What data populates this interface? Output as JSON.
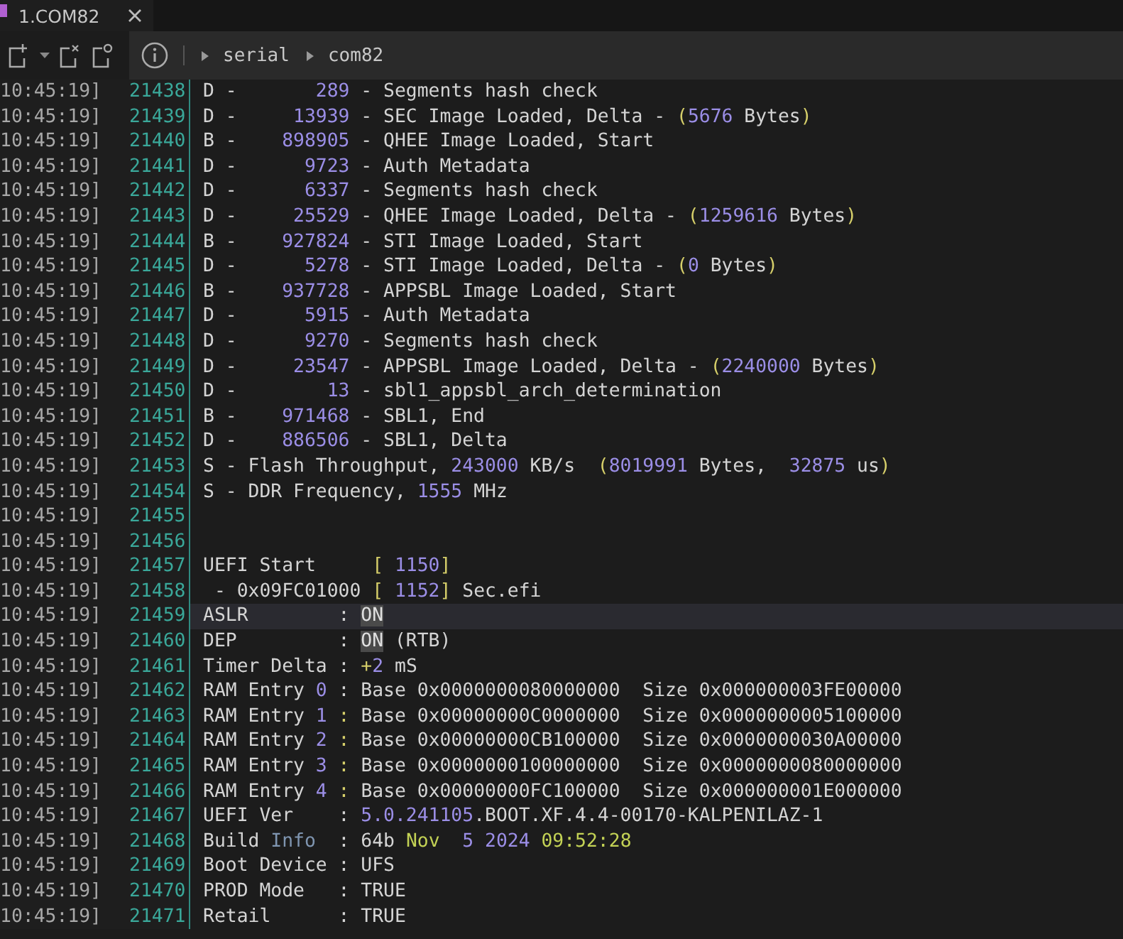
{
  "tabs": [
    {
      "label": "1.COM82",
      "selected": true
    }
  ],
  "breadcrumb": [
    "serial",
    "com82"
  ],
  "log": [
    {
      "time": "10:45:19]",
      "line": "21438",
      "selected": false,
      "segments": [
        {
          "kind": "text",
          "text": "D -       "
        },
        {
          "kind": "number",
          "text": "289"
        },
        {
          "kind": "text",
          "text": " - Segments hash check"
        }
      ]
    },
    {
      "time": "10:45:19]",
      "line": "21439",
      "selected": false,
      "segments": [
        {
          "kind": "text",
          "text": "D -     "
        },
        {
          "kind": "number",
          "text": "13939"
        },
        {
          "kind": "text",
          "text": " - SEC Image Loaded, Delta - "
        },
        {
          "kind": "punct",
          "text": "("
        },
        {
          "kind": "number",
          "text": "5676"
        },
        {
          "kind": "text",
          "text": " Bytes"
        },
        {
          "kind": "punct",
          "text": ")"
        }
      ]
    },
    {
      "time": "10:45:19]",
      "line": "21440",
      "selected": false,
      "segments": [
        {
          "kind": "text",
          "text": "B -    "
        },
        {
          "kind": "number",
          "text": "898905"
        },
        {
          "kind": "text",
          "text": " - QHEE Image Loaded, Start"
        }
      ]
    },
    {
      "time": "10:45:19]",
      "line": "21441",
      "selected": false,
      "segments": [
        {
          "kind": "text",
          "text": "D -      "
        },
        {
          "kind": "number",
          "text": "9723"
        },
        {
          "kind": "text",
          "text": " - Auth Metadata"
        }
      ]
    },
    {
      "time": "10:45:19]",
      "line": "21442",
      "selected": false,
      "segments": [
        {
          "kind": "text",
          "text": "D -      "
        },
        {
          "kind": "number",
          "text": "6337"
        },
        {
          "kind": "text",
          "text": " - Segments hash check"
        }
      ]
    },
    {
      "time": "10:45:19]",
      "line": "21443",
      "selected": false,
      "segments": [
        {
          "kind": "text",
          "text": "D -     "
        },
        {
          "kind": "number",
          "text": "25529"
        },
        {
          "kind": "text",
          "text": " - QHEE Image Loaded, Delta - "
        },
        {
          "kind": "punct",
          "text": "("
        },
        {
          "kind": "number",
          "text": "1259616"
        },
        {
          "kind": "text",
          "text": " Bytes"
        },
        {
          "kind": "punct",
          "text": ")"
        }
      ]
    },
    {
      "time": "10:45:19]",
      "line": "21444",
      "selected": false,
      "segments": [
        {
          "kind": "text",
          "text": "B -    "
        },
        {
          "kind": "number",
          "text": "927824"
        },
        {
          "kind": "text",
          "text": " - STI Image Loaded, Start"
        }
      ]
    },
    {
      "time": "10:45:19]",
      "line": "21445",
      "selected": false,
      "segments": [
        {
          "kind": "text",
          "text": "D -      "
        },
        {
          "kind": "number",
          "text": "5278"
        },
        {
          "kind": "text",
          "text": " - STI Image Loaded, Delta - "
        },
        {
          "kind": "punct",
          "text": "("
        },
        {
          "kind": "number",
          "text": "0"
        },
        {
          "kind": "text",
          "text": " Bytes"
        },
        {
          "kind": "punct",
          "text": ")"
        }
      ]
    },
    {
      "time": "10:45:19]",
      "line": "21446",
      "selected": false,
      "segments": [
        {
          "kind": "text",
          "text": "B -    "
        },
        {
          "kind": "number",
          "text": "937728"
        },
        {
          "kind": "text",
          "text": " - APPSBL Image Loaded, Start"
        }
      ]
    },
    {
      "time": "10:45:19]",
      "line": "21447",
      "selected": false,
      "segments": [
        {
          "kind": "text",
          "text": "D -      "
        },
        {
          "kind": "number",
          "text": "5915"
        },
        {
          "kind": "text",
          "text": " - Auth Metadata"
        }
      ]
    },
    {
      "time": "10:45:19]",
      "line": "21448",
      "selected": false,
      "segments": [
        {
          "kind": "text",
          "text": "D -      "
        },
        {
          "kind": "number",
          "text": "9270"
        },
        {
          "kind": "text",
          "text": " - Segments hash check"
        }
      ]
    },
    {
      "time": "10:45:19]",
      "line": "21449",
      "selected": false,
      "segments": [
        {
          "kind": "text",
          "text": "D -     "
        },
        {
          "kind": "number",
          "text": "23547"
        },
        {
          "kind": "text",
          "text": " - APPSBL Image Loaded, Delta - "
        },
        {
          "kind": "punct",
          "text": "("
        },
        {
          "kind": "number",
          "text": "2240000"
        },
        {
          "kind": "text",
          "text": " Bytes"
        },
        {
          "kind": "punct",
          "text": ")"
        }
      ]
    },
    {
      "time": "10:45:19]",
      "line": "21450",
      "selected": false,
      "segments": [
        {
          "kind": "text",
          "text": "D -        "
        },
        {
          "kind": "number",
          "text": "13"
        },
        {
          "kind": "text",
          "text": " - sbl1_appsbl_arch_determination"
        }
      ]
    },
    {
      "time": "10:45:19]",
      "line": "21451",
      "selected": false,
      "segments": [
        {
          "kind": "text",
          "text": "B -    "
        },
        {
          "kind": "number",
          "text": "971468"
        },
        {
          "kind": "text",
          "text": " - SBL1, End"
        }
      ]
    },
    {
      "time": "10:45:19]",
      "line": "21452",
      "selected": false,
      "segments": [
        {
          "kind": "text",
          "text": "D -    "
        },
        {
          "kind": "number",
          "text": "886506"
        },
        {
          "kind": "text",
          "text": " - SBL1, Delta"
        }
      ]
    },
    {
      "time": "10:45:19]",
      "line": "21453",
      "selected": false,
      "segments": [
        {
          "kind": "text",
          "text": "S - Flash Throughput, "
        },
        {
          "kind": "number",
          "text": "243000"
        },
        {
          "kind": "text",
          "text": " KB/s  "
        },
        {
          "kind": "punct",
          "text": "("
        },
        {
          "kind": "number",
          "text": "8019991"
        },
        {
          "kind": "text",
          "text": " Bytes,  "
        },
        {
          "kind": "number",
          "text": "32875"
        },
        {
          "kind": "text",
          "text": " us"
        },
        {
          "kind": "punct",
          "text": ")"
        }
      ]
    },
    {
      "time": "10:45:19]",
      "line": "21454",
      "selected": false,
      "segments": [
        {
          "kind": "text",
          "text": "S - DDR Frequency, "
        },
        {
          "kind": "number",
          "text": "1555"
        },
        {
          "kind": "text",
          "text": " MHz"
        }
      ]
    },
    {
      "time": "10:45:19]",
      "line": "21455",
      "selected": false
    },
    {
      "time": "10:45:19]",
      "line": "21456",
      "selected": false
    },
    {
      "time": "10:45:19]",
      "line": "21457",
      "selected": false,
      "segments": [
        {
          "kind": "text",
          "text": "UEFI Start     "
        },
        {
          "kind": "punct",
          "text": "[ "
        },
        {
          "kind": "number",
          "text": "1150"
        },
        {
          "kind": "punct",
          "text": "]"
        }
      ]
    },
    {
      "time": "10:45:19]",
      "line": "21458",
      "selected": false,
      "segments": [
        {
          "kind": "text",
          "text": " - 0x09FC01000 "
        },
        {
          "kind": "punct",
          "text": "[ "
        },
        {
          "kind": "number",
          "text": "1152"
        },
        {
          "kind": "punct",
          "text": "]"
        },
        {
          "kind": "text",
          "text": " Sec.efi"
        }
      ]
    },
    {
      "time": "10:45:19]",
      "line": "21459",
      "selected": true,
      "segments": [
        {
          "kind": "text",
          "text": "ASLR        : "
        },
        {
          "kind": "match",
          "text": "ON"
        }
      ]
    },
    {
      "time": "10:45:19]",
      "line": "21460",
      "selected": false,
      "segments": [
        {
          "kind": "text",
          "text": "DEP         : "
        },
        {
          "kind": "match",
          "text": "ON"
        },
        {
          "kind": "text",
          "text": " (RTB)"
        }
      ]
    },
    {
      "time": "10:45:19]",
      "line": "21461",
      "selected": false,
      "segments": [
        {
          "kind": "text",
          "text": "Timer Delta : "
        },
        {
          "kind": "punct",
          "text": "+"
        },
        {
          "kind": "number",
          "text": "2"
        },
        {
          "kind": "text",
          "text": " mS"
        }
      ]
    },
    {
      "time": "10:45:19]",
      "line": "21462",
      "selected": false,
      "segments": [
        {
          "kind": "text",
          "text": "RAM Entry "
        },
        {
          "kind": "number",
          "text": "0"
        },
        {
          "kind": "text",
          "text": " : Base 0x0000000080000000  Size 0x000000003FE00000"
        }
      ]
    },
    {
      "time": "10:45:19]",
      "line": "21463",
      "selected": false,
      "segments": [
        {
          "kind": "text",
          "text": "RAM Entry "
        },
        {
          "kind": "number",
          "text": "1"
        },
        {
          "kind": "punct",
          "text": " :"
        },
        {
          "kind": "text",
          "text": " Base 0x00000000C0000000  Size 0x0000000005100000"
        }
      ]
    },
    {
      "time": "10:45:19]",
      "line": "21464",
      "selected": false,
      "segments": [
        {
          "kind": "text",
          "text": "RAM Entry "
        },
        {
          "kind": "number",
          "text": "2"
        },
        {
          "kind": "punct",
          "text": " :"
        },
        {
          "kind": "text",
          "text": " Base 0x00000000CB100000  Size 0x0000000030A00000"
        }
      ]
    },
    {
      "time": "10:45:19]",
      "line": "21465",
      "selected": false,
      "segments": [
        {
          "kind": "text",
          "text": "RAM Entry "
        },
        {
          "kind": "number",
          "text": "3"
        },
        {
          "kind": "punct",
          "text": " :"
        },
        {
          "kind": "text",
          "text": " Base 0x0000000100000000  Size 0x0000000080000000"
        }
      ]
    },
    {
      "time": "10:45:19]",
      "line": "21466",
      "selected": false,
      "segments": [
        {
          "kind": "text",
          "text": "RAM Entry "
        },
        {
          "kind": "number",
          "text": "4"
        },
        {
          "kind": "punct",
          "text": " :"
        },
        {
          "kind": "text",
          "text": " Base 0x00000000FC100000  Size 0x000000001E000000"
        }
      ]
    },
    {
      "time": "10:45:19]",
      "line": "21467",
      "selected": false,
      "segments": [
        {
          "kind": "text",
          "text": "UEFI Ver    : "
        },
        {
          "kind": "number",
          "text": "5.0.241105"
        },
        {
          "kind": "text",
          "text": ".BOOT.XF.4.4-00170-KALPENILAZ-1"
        }
      ]
    },
    {
      "time": "10:45:19]",
      "line": "21468",
      "selected": false,
      "segments": [
        {
          "kind": "text",
          "text": "Build "
        },
        {
          "kind": "keyword",
          "text": "Info"
        },
        {
          "kind": "text",
          "text": "  : 64b "
        },
        {
          "kind": "date",
          "text": "Nov"
        },
        {
          "kind": "number",
          "text": "  5 2024"
        },
        {
          "kind": "date",
          "text": " 09:52:28"
        }
      ]
    },
    {
      "time": "10:45:19]",
      "line": "21469",
      "selected": false,
      "segments": [
        {
          "kind": "text",
          "text": "Boot Device : UFS"
        }
      ]
    },
    {
      "time": "10:45:19]",
      "line": "21470",
      "selected": false,
      "segments": [
        {
          "kind": "text",
          "text": "PROD Mode   : TRUE"
        }
      ]
    },
    {
      "time": "10:45:19]",
      "line": "21471",
      "selected": false,
      "segments": [
        {
          "kind": "text",
          "text": "Retail      : TRUE"
        }
      ]
    }
  ]
}
